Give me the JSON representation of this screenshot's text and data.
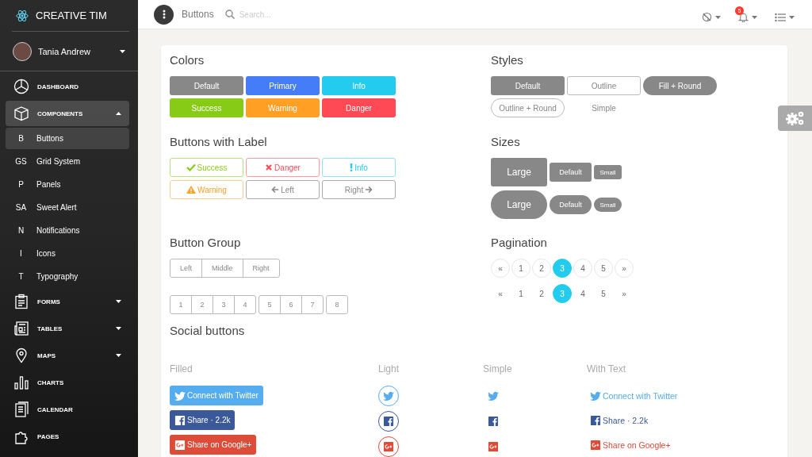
{
  "sidebar": {
    "brand": "CREATIVE TIM",
    "user": {
      "name": "Tania Andrew"
    },
    "items": [
      {
        "label": "DASHBOARD",
        "selected": false
      },
      {
        "label": "COMPONENTS",
        "selected": true,
        "expanded": true,
        "children": [
          {
            "abbr": "B",
            "label": "Buttons",
            "selected": true
          },
          {
            "abbr": "GS",
            "label": "Grid System",
            "selected": false
          },
          {
            "abbr": "P",
            "label": "Panels",
            "selected": false
          },
          {
            "abbr": "SA",
            "label": "Sweet Alert",
            "selected": false
          },
          {
            "abbr": "N",
            "label": "Notifications",
            "selected": false
          },
          {
            "abbr": "I",
            "label": "Icons",
            "selected": false
          },
          {
            "abbr": "T",
            "label": "Typography",
            "selected": false
          }
        ]
      },
      {
        "label": "FORMS",
        "selected": false,
        "expanded": false
      },
      {
        "label": "TABLES",
        "selected": false,
        "expanded": false
      },
      {
        "label": "MAPS",
        "selected": false,
        "expanded": false
      },
      {
        "label": "CHARTS",
        "selected": false
      },
      {
        "label": "CALENDAR",
        "selected": false
      },
      {
        "label": "PAGES",
        "selected": false
      }
    ]
  },
  "navbar": {
    "title": "Buttons",
    "search": {
      "placeholder": "Search..."
    },
    "notifications_badge": "5"
  },
  "colors": {
    "title": "Colors",
    "buttons": [
      {
        "label": "Default",
        "kind": "default"
      },
      {
        "label": "Primary",
        "kind": "primary"
      },
      {
        "label": "Info",
        "kind": "info"
      },
      {
        "label": "Success",
        "kind": "success"
      },
      {
        "label": "Warning",
        "kind": "warning"
      },
      {
        "label": "Danger",
        "kind": "danger"
      }
    ]
  },
  "styles": {
    "title": "Styles",
    "buttons": [
      {
        "label": "Default",
        "kind": "fill"
      },
      {
        "label": "Outline",
        "kind": "outline"
      },
      {
        "label": "Fill + Round",
        "kind": "fill-round"
      },
      {
        "label": "Outline + Round",
        "kind": "outline-round"
      },
      {
        "label": "Simple",
        "kind": "simple"
      }
    ]
  },
  "labeled": {
    "title": "Buttons with Label",
    "buttons": [
      {
        "label": "Success",
        "kind": "success"
      },
      {
        "label": "Danger",
        "kind": "danger"
      },
      {
        "label": "Info",
        "kind": "info"
      },
      {
        "label": "Warning",
        "kind": "warning"
      },
      {
        "label": "Left",
        "kind": "left"
      },
      {
        "label": "Right",
        "kind": "right"
      }
    ]
  },
  "sizes": {
    "title": "Sizes",
    "rows": [
      {
        "kind": "square",
        "buttons": [
          "Large",
          "Default",
          "Small"
        ]
      },
      {
        "kind": "round",
        "buttons": [
          "Large",
          "Default",
          "Small"
        ]
      }
    ]
  },
  "button_group": {
    "title": "Button Group",
    "group": [
      "Left",
      "Middle",
      "Right"
    ],
    "number_groups": [
      [
        "1",
        "2",
        "3",
        "4"
      ],
      [
        "5",
        "6",
        "7"
      ],
      [
        "8"
      ]
    ]
  },
  "pagination": {
    "title": "Pagination",
    "bars": [
      {
        "kind": "bordered",
        "items": [
          {
            "label": "«",
            "selected": false
          },
          {
            "label": "1",
            "selected": false
          },
          {
            "label": "2",
            "selected": false
          },
          {
            "label": "3",
            "selected": true
          },
          {
            "label": "4",
            "selected": false
          },
          {
            "label": "5",
            "selected": false
          },
          {
            "label": "»",
            "selected": false
          }
        ]
      },
      {
        "kind": "plain",
        "items": [
          {
            "label": "«",
            "selected": false
          },
          {
            "label": "1",
            "selected": false
          },
          {
            "label": "2",
            "selected": false
          },
          {
            "label": "3",
            "selected": true
          },
          {
            "label": "4",
            "selected": false
          },
          {
            "label": "5",
            "selected": false
          },
          {
            "label": "»",
            "selected": false
          }
        ]
      }
    ]
  },
  "social": {
    "title": "Social buttons",
    "columns": [
      {
        "heading": "Filled",
        "kind": "filled",
        "items": [
          {
            "kind": "twitter",
            "color": "#55acee",
            "label": "Connect with Twitter"
          },
          {
            "kind": "facebook",
            "color": "#3b5998",
            "label": "Share · 2.2k"
          },
          {
            "kind": "google",
            "color": "#dd4b39",
            "label": "Share on Google+"
          }
        ]
      },
      {
        "heading": "Light",
        "kind": "light",
        "items": [
          {
            "kind": "twitter",
            "color": "#55acee"
          },
          {
            "kind": "facebook",
            "color": "#3b5998"
          },
          {
            "kind": "google",
            "color": "#dd4b39"
          }
        ]
      },
      {
        "heading": "Simple",
        "kind": "simple",
        "items": [
          {
            "kind": "twitter",
            "color": "#55acee"
          },
          {
            "kind": "facebook",
            "color": "#3b5998"
          },
          {
            "kind": "google",
            "color": "#dd4b39"
          }
        ]
      },
      {
        "heading": "With Text",
        "kind": "text",
        "items": [
          {
            "kind": "twitter",
            "color": "#55acee",
            "label": "Connect with Twitter"
          },
          {
            "kind": "facebook",
            "color": "#3b5998",
            "label": "Share · 2.2k"
          },
          {
            "kind": "google",
            "color": "#dd4b39",
            "label": "Share on Google+"
          }
        ]
      }
    ]
  }
}
